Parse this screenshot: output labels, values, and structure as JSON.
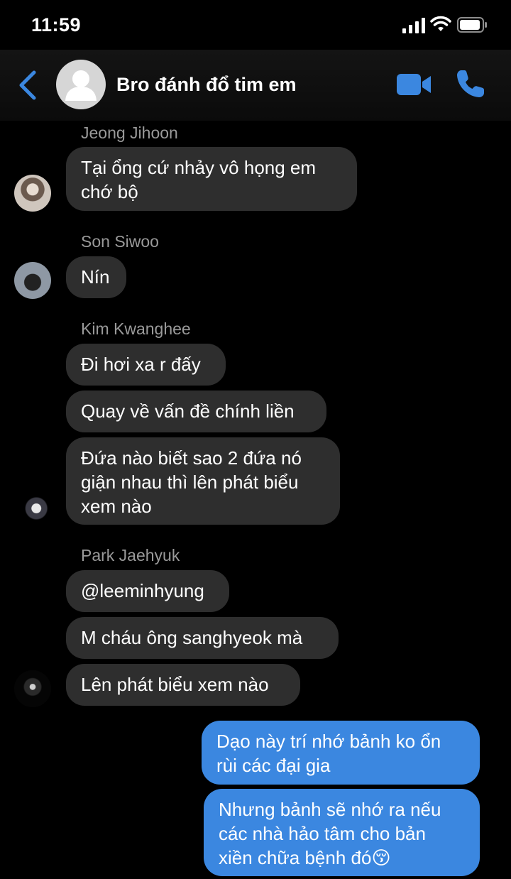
{
  "status": {
    "time": "11:59"
  },
  "header": {
    "title": "Bro đánh đổ tim em"
  },
  "colors": {
    "accent": "#3b87e0",
    "bubble_in": "#2e2e2e",
    "background": "#000000"
  },
  "groups": [
    {
      "sender": "Jeong Jihoon",
      "messages": [
        "Tại ổng cứ nhảy vô họng em\nchớ bộ"
      ]
    },
    {
      "sender": "Son Siwoo",
      "messages": [
        "Nín"
      ]
    },
    {
      "sender": "Kim Kwanghee",
      "messages": [
        "Đi hơi xa r đấy",
        "Quay về vấn đề chính liền",
        "Đứa nào biết sao 2 đứa nó\ngiận nhau thì lên phát biểu\nxem nào"
      ]
    },
    {
      "sender": "Park Jaehyuk",
      "messages": [
        "@leeminhyung",
        "M cháu ông sanghyeok mà",
        "Lên phát biểu xem nào"
      ]
    }
  ],
  "outgoing": [
    "Dạo này trí nhớ bảnh ko ổn\nrùi các đại gia",
    "Nhưng bảnh sẽ nhớ ra nếu\ncác nhà hảo tâm cho bản\nxiền chữa bệnh đó😚"
  ]
}
